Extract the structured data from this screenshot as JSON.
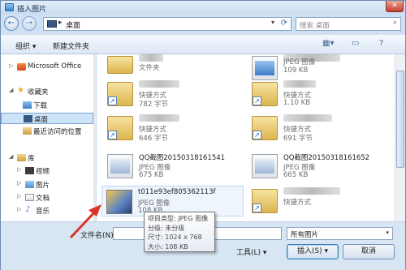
{
  "window": {
    "title": "插入图片",
    "close_label": "✕"
  },
  "nav": {
    "back_icon": "←",
    "forward_icon": "→",
    "address": "桌面",
    "address_sep": "▸",
    "address_dropdown": "▾",
    "refresh_icon": "⟳",
    "search_placeholder": "搜索 桌面",
    "search_icon": "⌕"
  },
  "toolbar": {
    "organize_label": "组织 ▾",
    "new_folder_label": "新建文件夹"
  },
  "sidebar": {
    "items": [
      {
        "label": "Microsoft Office",
        "expander": "▷"
      },
      {
        "label": "收藏夹",
        "expander": "◢"
      },
      {
        "label": "下载",
        "expander": ""
      },
      {
        "label": "桌面",
        "expander": ""
      },
      {
        "label": "最近访问的位置",
        "expander": ""
      },
      {
        "label": "库",
        "expander": "◢"
      },
      {
        "label": "视频",
        "expander": "▷"
      },
      {
        "label": "图片",
        "expander": "▷"
      },
      {
        "label": "文档",
        "expander": "▷"
      },
      {
        "label": "音乐",
        "expander": "▷"
      }
    ]
  },
  "files": [
    {
      "name": "",
      "type": "文件夹",
      "size": ""
    },
    {
      "name": "",
      "type": "JPEG 图像",
      "size": "109 KB"
    },
    {
      "name": "",
      "type": "快捷方式",
      "size": "782 字节"
    },
    {
      "name": "",
      "type": "快捷方式",
      "size": "1.10 KB"
    },
    {
      "name": "",
      "type": "快捷方式",
      "size": "646 字节"
    },
    {
      "name": "",
      "type": "快捷方式",
      "size": "691 字节"
    },
    {
      "name": "QQ截图20150318161541",
      "type": "JPEG 图像",
      "size": "675 KB"
    },
    {
      "name": "QQ截图20150318161652",
      "type": "JPEG 图像",
      "size": "665 KB"
    },
    {
      "name": "t011e93ef805362113f",
      "type": "JPEG 图像",
      "size": "108 KB"
    },
    {
      "name": "",
      "type": "快捷方式",
      "size": ""
    }
  ],
  "tooltip": {
    "line1": "项目类型: JPEG 图像",
    "line2": "分级: 未分级",
    "line3": "尺寸: 1024 x 768",
    "line4": "大小: 108 KB"
  },
  "bottom": {
    "filename_label": "文件名(N):",
    "filename_value": "",
    "filter_value": "所有图片",
    "filter_dropdown": "▾",
    "tools_label": "工具(L) ▾",
    "insert_label": "插入(S) ▾",
    "cancel_label": "取消"
  },
  "colors": {
    "arrow": "#d9342b",
    "selection": "#cce4f8"
  }
}
